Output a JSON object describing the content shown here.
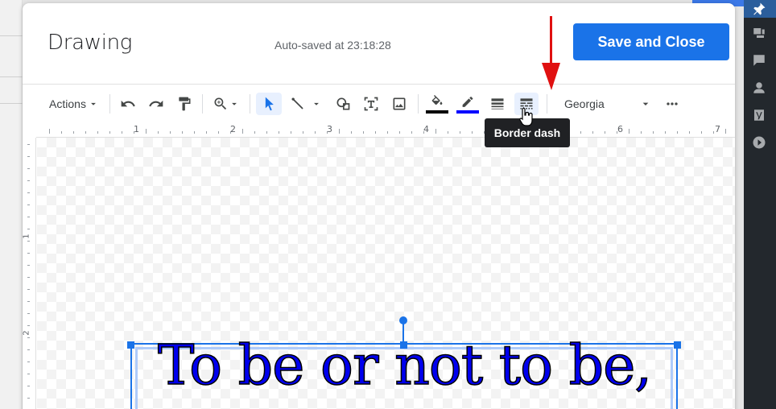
{
  "dialog": {
    "title": "Drawing",
    "autosave": "Auto-saved at 23:18:28",
    "save_button": "Save and Close"
  },
  "toolbar": {
    "actions_label": "Actions",
    "font": "Georgia",
    "line_color": "#000000",
    "border_color": "#0000ff"
  },
  "tooltip": "Border dash",
  "ruler": {
    "h_numbers": [
      "1",
      "2",
      "3",
      "4",
      "6",
      "7"
    ],
    "v_numbers": [
      "1",
      "2"
    ]
  },
  "canvas": {
    "text": "To be or not to be,"
  },
  "colors": {
    "accent": "#1a73e8",
    "text_fill": "#0000ee",
    "annotation_arrow": "#e01010"
  }
}
